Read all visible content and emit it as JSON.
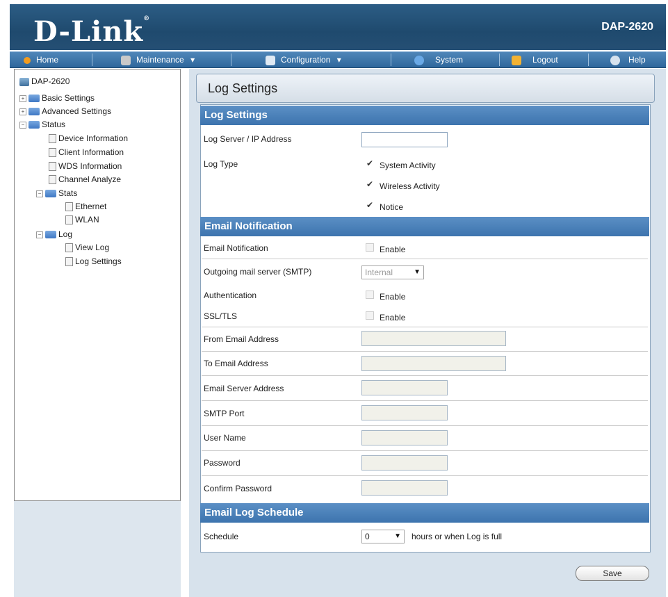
{
  "header": {
    "logo": "D-Link",
    "model": "DAP-2620"
  },
  "menu": {
    "home": "Home",
    "maintenance": "Maintenance",
    "configuration": "Configuration",
    "system": "System",
    "logout": "Logout",
    "help": "Help",
    "dropdown_glyph": "▾"
  },
  "tree": {
    "root": "DAP-2620",
    "basic_settings": "Basic Settings",
    "advanced_settings": "Advanced Settings",
    "status": "Status",
    "device_information": "Device Information",
    "client_information": "Client Information",
    "wds_information": "WDS Information",
    "channel_analyze": "Channel Analyze",
    "stats": "Stats",
    "ethernet": "Ethernet",
    "wlan": "WLAN",
    "log": "Log",
    "view_log": "View Log",
    "log_settings": "Log Settings"
  },
  "page": {
    "title": "Log Settings",
    "log_settings_section": {
      "header": "Log Settings",
      "server_label": "Log Server / IP Address",
      "server_value": "",
      "log_type_label": "Log Type",
      "system_activity": "System Activity",
      "wireless_activity": "Wireless Activity",
      "notice": "Notice",
      "check_glyph": "✔"
    },
    "email_section": {
      "header": "Email Notification",
      "email_notification_label": "Email Notification",
      "enable": "Enable",
      "smtp_label": "Outgoing mail server (SMTP)",
      "smtp_value": "Internal",
      "authentication_label": "Authentication",
      "ssl_label": "SSL/TLS",
      "from_label": "From Email Address",
      "to_label": "To Email Address",
      "server_address_label": "Email Server Address",
      "smtp_port_label": "SMTP Port",
      "user_name_label": "User Name",
      "password_label": "Password",
      "confirm_password_label": "Confirm Password"
    },
    "schedule_section": {
      "header": "Email Log Schedule",
      "schedule_label": "Schedule",
      "schedule_value": "0",
      "schedule_suffix": "hours or when Log is full"
    },
    "save_button": "Save"
  },
  "colors": {
    "header_bg": "#1f4a6e",
    "menubar_bg": "#3a72a8",
    "section_header_bg": "#4a80b9",
    "panel_bg": "#d7e2ec"
  }
}
